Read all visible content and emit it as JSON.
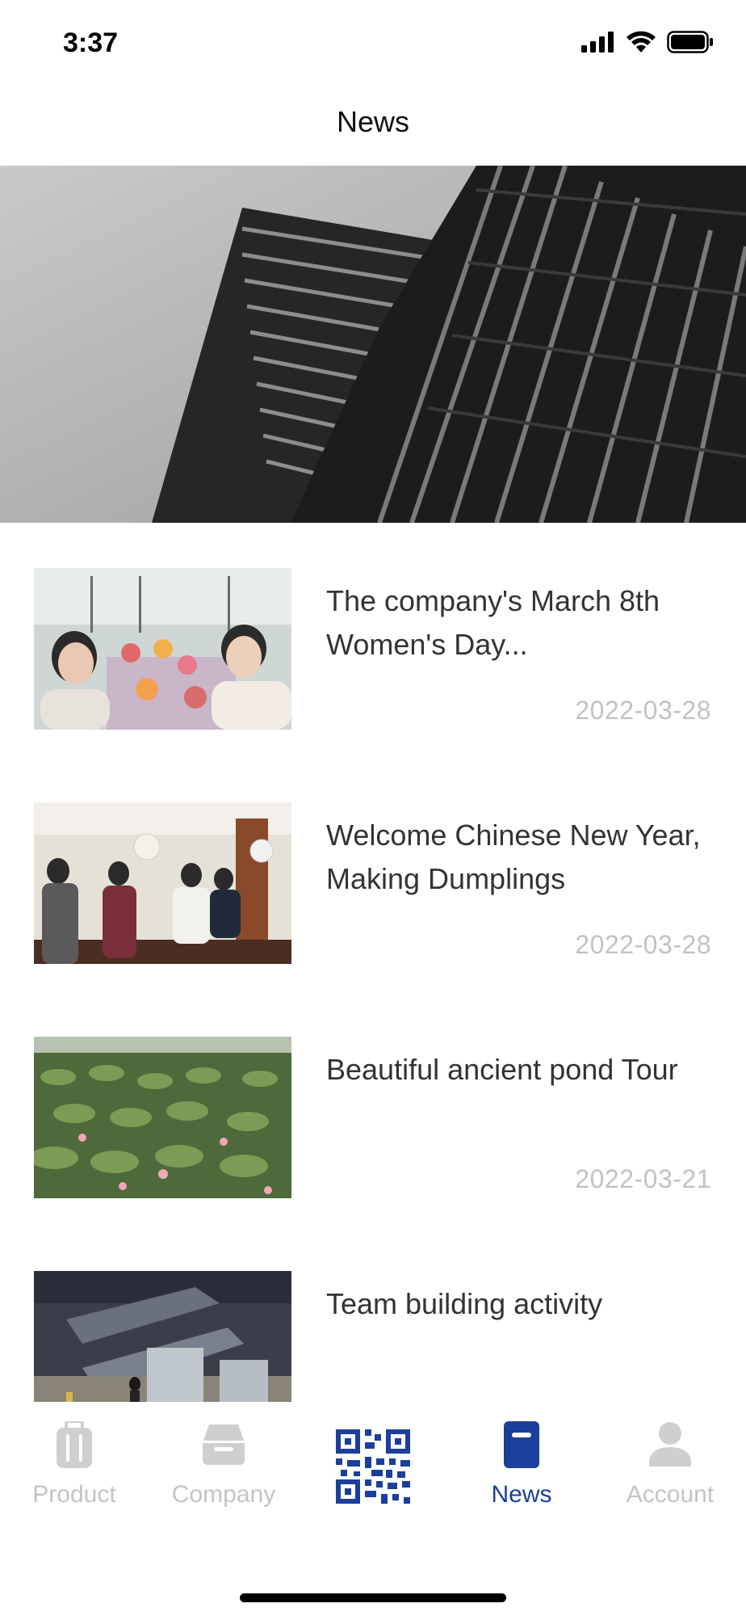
{
  "status_bar": {
    "time": "3:37"
  },
  "header": {
    "title": "News"
  },
  "news": [
    {
      "title": "The company's March 8th Women's Day...",
      "date": "2022-03-28"
    },
    {
      "title": "Welcome Chinese New Year, Making Dumplings",
      "date": "2022-03-28"
    },
    {
      "title": "Beautiful ancient pond Tour",
      "date": "2022-03-21"
    },
    {
      "title": "Team building activity",
      "date": ""
    }
  ],
  "tab_bar": {
    "items": [
      {
        "label": "Product",
        "icon": "suitcase-icon",
        "active": false
      },
      {
        "label": "Company",
        "icon": "inbox-icon",
        "active": false
      },
      {
        "label": "",
        "icon": "qr-code-icon",
        "active": false
      },
      {
        "label": "News",
        "icon": "book-icon",
        "active": true
      },
      {
        "label": "Account",
        "icon": "person-icon",
        "active": false
      }
    ]
  },
  "colors": {
    "accent": "#1b3f9a",
    "inactive": "#c4c4c4",
    "date": "#c2c2c2"
  }
}
